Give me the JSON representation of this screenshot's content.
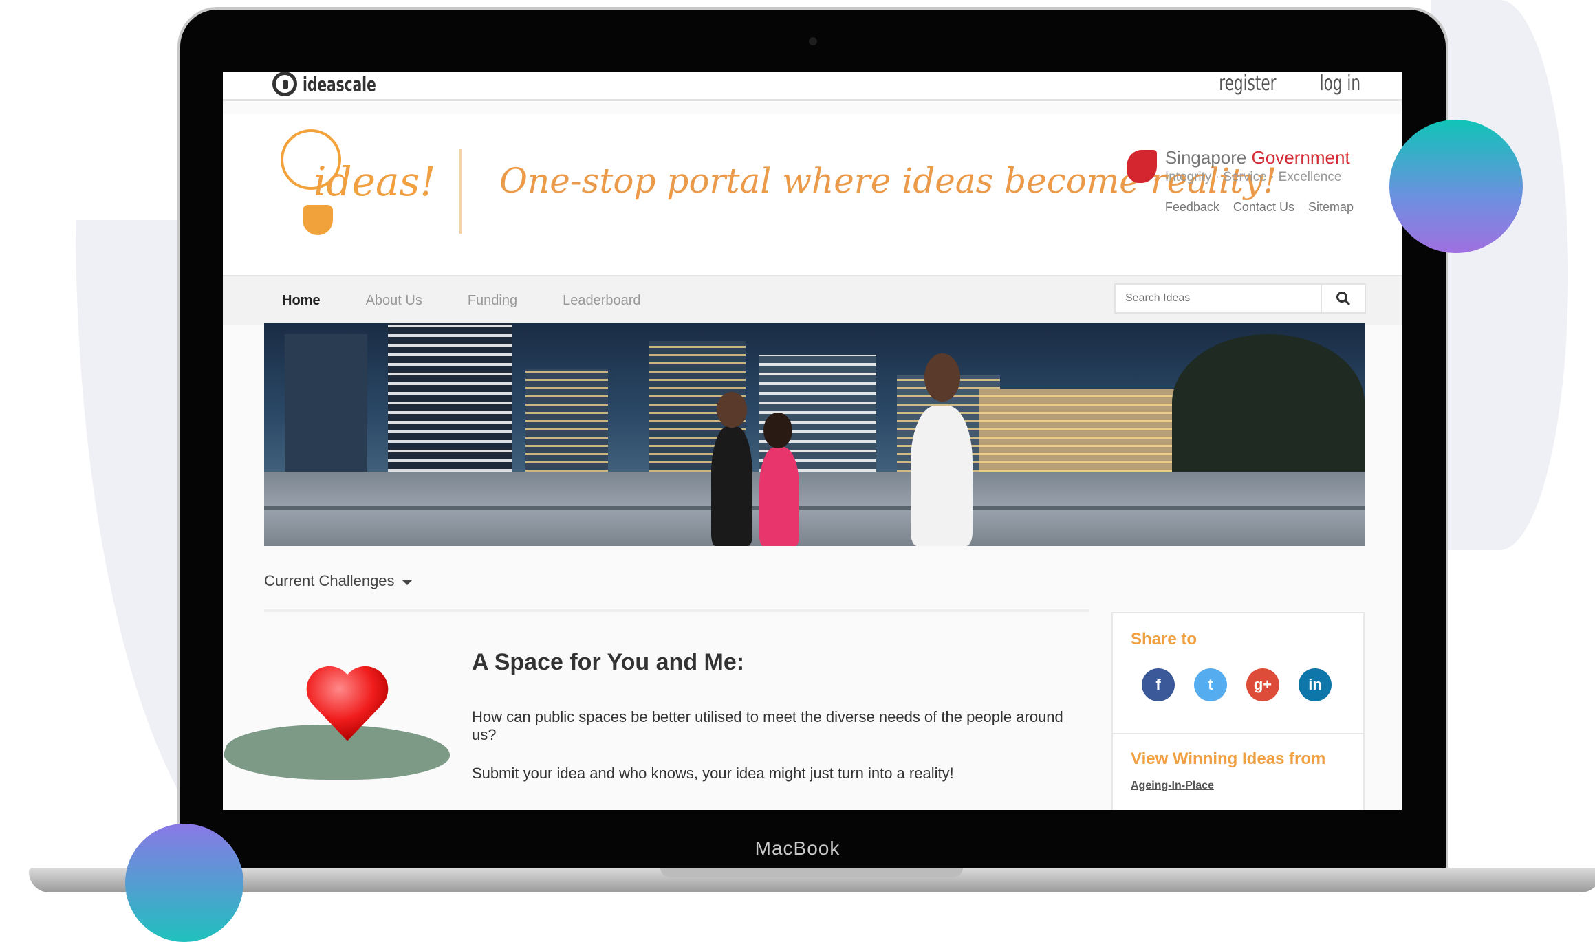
{
  "topbar": {
    "brand": "ideascale",
    "register": "register",
    "login": "log in"
  },
  "header": {
    "logo_text": "ideas!",
    "tagline": "One-stop portal where ideas become reality!",
    "gov_name_a": "Singapore",
    "gov_name_b": "Government",
    "gov_motto": "Integrity  ·  Service  ·  Excellence",
    "links": [
      "Feedback",
      "Contact Us",
      "Sitemap"
    ]
  },
  "nav": {
    "items": [
      "Home",
      "About Us",
      "Funding",
      "Leaderboard"
    ],
    "active": "Home",
    "search_placeholder": "Search Ideas"
  },
  "content": {
    "filter_label": "Current Challenges",
    "challenge_title": "A Space for You and Me:",
    "challenge_question": "How can public spaces be better utilised to meet the diverse needs of the people around us?",
    "challenge_cta": "Submit your idea and who knows, your idea might just turn into a reality!"
  },
  "sidebar": {
    "share_title": "Share to",
    "share_icons": [
      {
        "name": "facebook-icon",
        "glyph": "f",
        "color": "#3b5998"
      },
      {
        "name": "twitter-icon",
        "glyph": "t",
        "color": "#55acee"
      },
      {
        "name": "google-plus-icon",
        "glyph": "g+",
        "color": "#dd4b39"
      },
      {
        "name": "linkedin-icon",
        "glyph": "in",
        "color": "#0e76a8"
      }
    ],
    "winning_title": "View Winning Ideas from",
    "winning_link": "Ageing-In-Place"
  },
  "device": {
    "label": "MacBook"
  },
  "colors": {
    "accent": "#f0a040",
    "gov_red": "#d42b36",
    "teal": "#10c4b7",
    "purple": "#a070e0"
  }
}
